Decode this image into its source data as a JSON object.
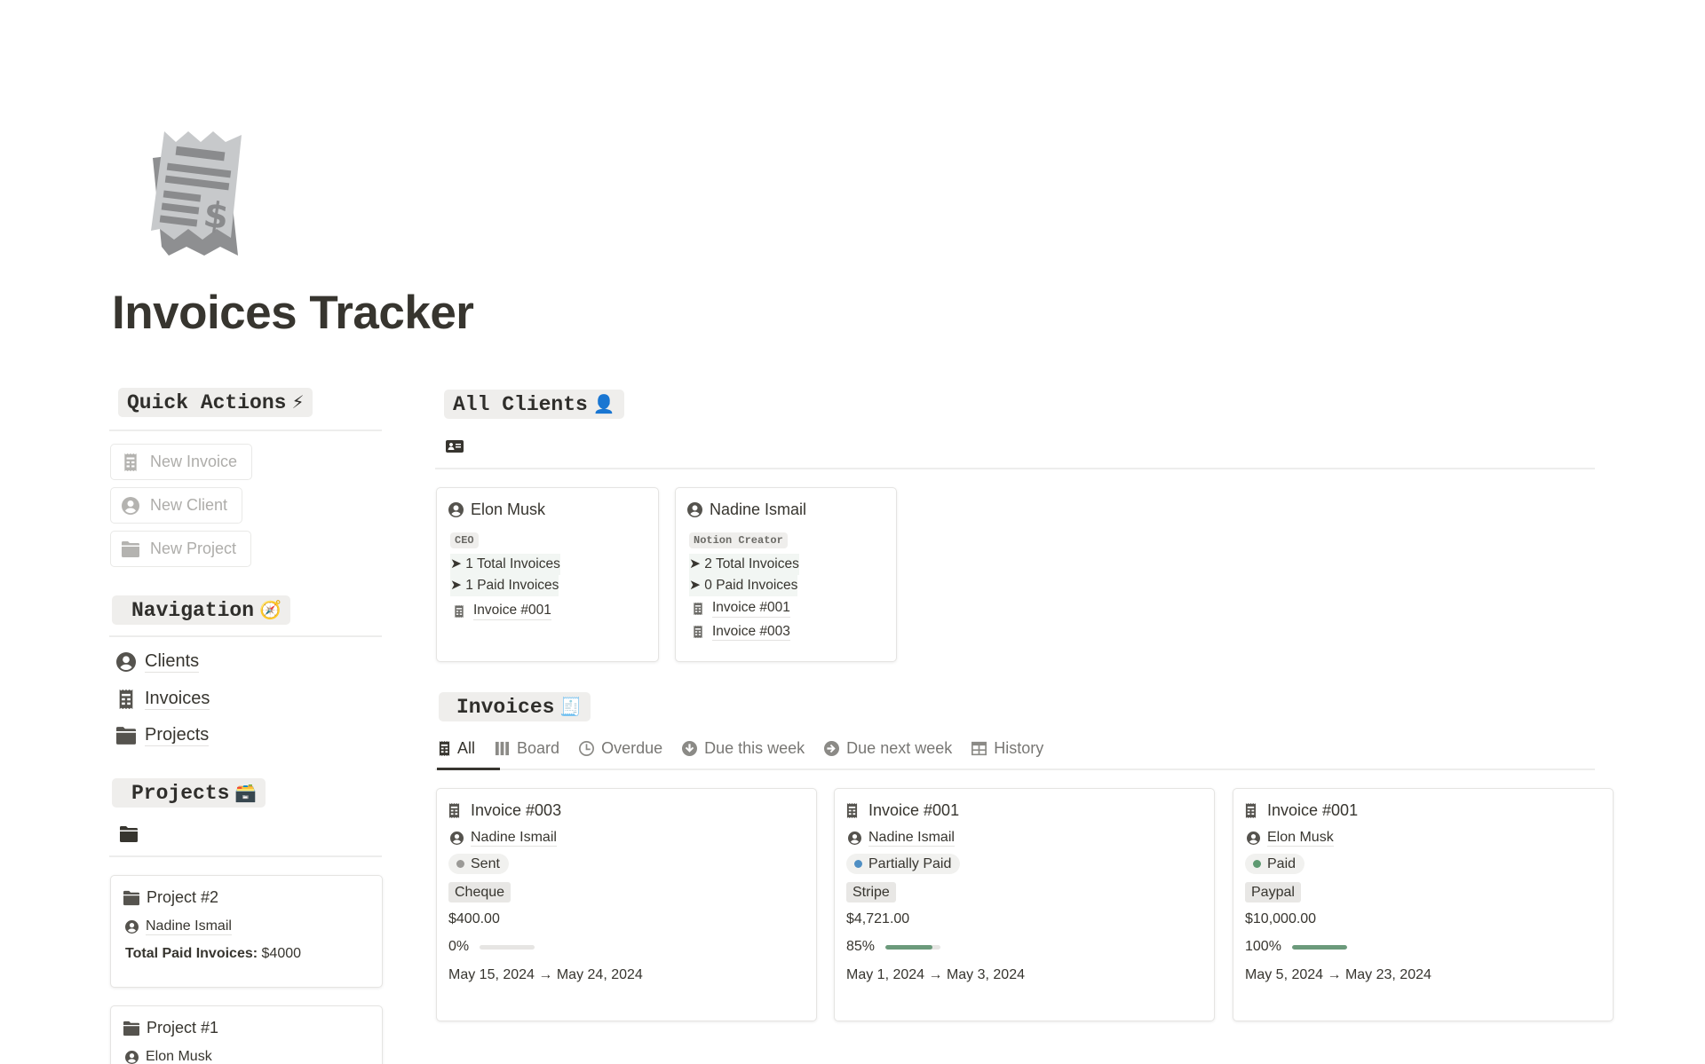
{
  "page": {
    "title": "Invoices Tracker",
    "icon": "receipt-icon"
  },
  "quick_actions": {
    "heading": "Quick Actions",
    "heading_emoji": "⚡",
    "buttons": [
      {
        "label": "New Invoice",
        "icon": "receipt-icon"
      },
      {
        "label": "New Client",
        "icon": "user-circle-icon"
      },
      {
        "label": "New Project",
        "icon": "folder-icon"
      }
    ]
  },
  "navigation": {
    "heading": "Navigation",
    "heading_emoji": "🧭",
    "links": [
      {
        "label": "Clients",
        "icon": "user-circle-icon"
      },
      {
        "label": "Invoices",
        "icon": "receipt-icon"
      },
      {
        "label": "Projects",
        "icon": "folder-icon"
      }
    ]
  },
  "projects": {
    "heading": "Projects",
    "heading_emoji": "🗃️",
    "view_icon": "folder-icon",
    "cards": [
      {
        "title": "Project #2",
        "client": "Nadine Ismail",
        "total_label": "Total Paid Invoices:",
        "total_value": "$4000"
      },
      {
        "title": "Project #1",
        "client": "Elon Musk"
      }
    ]
  },
  "clients": {
    "heading": "All Clients",
    "heading_emoji": "👤",
    "view_icon": "contact-card-icon",
    "cards": [
      {
        "name": "Elon Musk",
        "role": "CEO",
        "total_invoices": "➤ 1 Total Invoices",
        "paid_invoices": "➤ 1 Paid Invoices",
        "invoices": [
          "Invoice #001"
        ]
      },
      {
        "name": "Nadine Ismail",
        "role": "Notion Creator",
        "total_invoices": "➤ 2 Total Invoices",
        "paid_invoices": "➤ 0 Paid Invoices",
        "invoices": [
          "Invoice #001",
          "Invoice #003"
        ]
      }
    ]
  },
  "invoices": {
    "heading": "Invoices",
    "heading_emoji": "🧾",
    "tabs": [
      {
        "label": "All",
        "icon": "receipt-icon",
        "active": true
      },
      {
        "label": "Board",
        "icon": "board-columns-icon",
        "active": false
      },
      {
        "label": "Overdue",
        "icon": "clock-icon",
        "active": false
      },
      {
        "label": "Due this week",
        "icon": "arrow-down-circle-icon",
        "active": false
      },
      {
        "label": "Due next week",
        "icon": "arrow-right-circle-icon",
        "active": false
      },
      {
        "label": "History",
        "icon": "table-icon",
        "active": false
      }
    ],
    "cards": [
      {
        "title": "Invoice #003",
        "client": "Nadine Ismail",
        "status": "Sent",
        "status_color": "#9b9a97",
        "method": "Cheque",
        "amount": "$400.00",
        "progress_label": "0%",
        "progress": 0,
        "dates": "May 15, 2024 → May 24, 2024"
      },
      {
        "title": "Invoice #001",
        "client": "Nadine Ismail",
        "status": "Partially Paid",
        "status_color": "#4f8fc4",
        "method": "Stripe",
        "amount": "$4,721.00",
        "progress_label": "85%",
        "progress": 0.85,
        "dates": "May 1, 2024 → May 3, 2024"
      },
      {
        "title": "Invoice #001",
        "client": "Elon Musk",
        "status": "Paid",
        "status_color": "#5f9a72",
        "method": "Paypal",
        "amount": "$10,000.00",
        "progress_label": "100%",
        "progress": 1.0,
        "dates": "May 5, 2024 → May 23, 2024"
      }
    ]
  },
  "colors": {
    "text": "#37352f",
    "progress_fill": "#6b9a7b",
    "progress_track": "#e6e5e3",
    "pill_bg": "#efeeec"
  }
}
